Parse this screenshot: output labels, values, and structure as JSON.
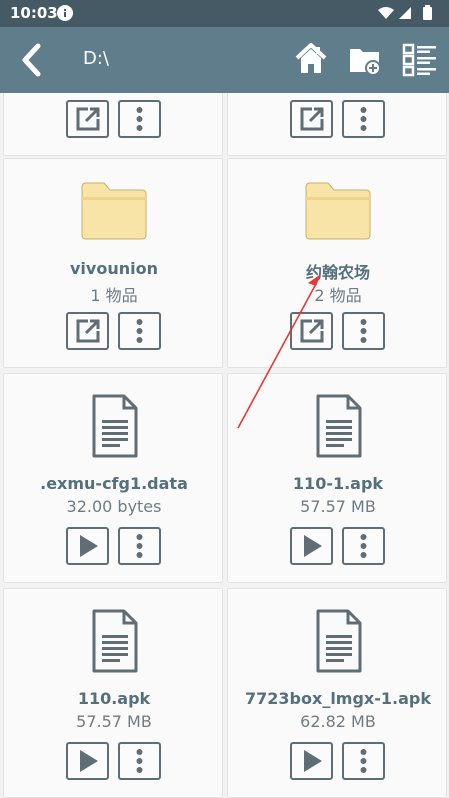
{
  "status": {
    "time": "10:03"
  },
  "toolbar": {
    "path": "D:\\"
  },
  "files": [
    {
      "type": "folder",
      "name": "vivounion",
      "sub": "1 物品"
    },
    {
      "type": "folder",
      "name": "约翰农场",
      "sub": "2 物品"
    },
    {
      "type": "file",
      "name": ".exmu-cfg1.data",
      "sub": "32.00 bytes"
    },
    {
      "type": "file",
      "name": "110-1.apk",
      "sub": "57.57 MB"
    },
    {
      "type": "file",
      "name": "110.apk",
      "sub": "57.57 MB"
    },
    {
      "type": "file",
      "name": "7723box_lmgx-1.apk",
      "sub": "62.82 MB"
    }
  ],
  "colors": {
    "statusbar": "#455a64",
    "toolbar": "#607d8b",
    "folder": "#f8e4a6",
    "icon": "#5f6e76",
    "annotation_arrow": "#e53935"
  },
  "icons": {
    "back": "chevron-left-icon",
    "home": "home-icon",
    "new_folder": "folder-add-icon",
    "list": "list-view-icon",
    "open": "open-external-icon",
    "more": "more-vert-icon",
    "play": "play-icon"
  }
}
